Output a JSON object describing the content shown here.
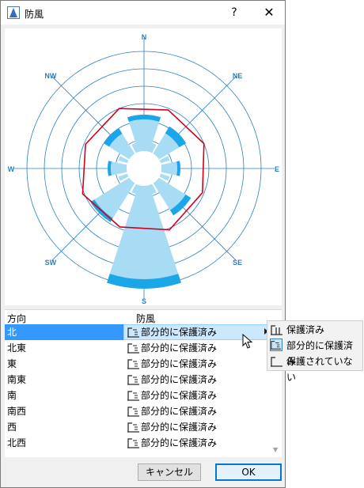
{
  "window": {
    "title": "防風",
    "help_label": "?",
    "close_label": "✕"
  },
  "chart_data": {
    "type": "rose",
    "directions": [
      "N",
      "NE",
      "E",
      "SE",
      "S",
      "SW",
      "W",
      "NW"
    ],
    "colors": {
      "light": "#a8dcf5",
      "mid": "#1aa6e8",
      "dark": "#0d6ab8",
      "outline": "#d0021b",
      "grid": "#2a7fc1"
    }
  },
  "list": {
    "headers": {
      "direction": "方向",
      "protection": "防風"
    },
    "rows": [
      {
        "direction": "北",
        "protection": "部分的に保護済み"
      },
      {
        "direction": "北東",
        "protection": "部分的に保護済み"
      },
      {
        "direction": "東",
        "protection": "部分的に保護済み"
      },
      {
        "direction": "南東",
        "protection": "部分的に保護済み"
      },
      {
        "direction": "南",
        "protection": "部分的に保護済み"
      },
      {
        "direction": "南西",
        "protection": "部分的に保護済み"
      },
      {
        "direction": "西",
        "protection": "部分的に保護済み"
      },
      {
        "direction": "北西",
        "protection": "部分的に保護済み"
      }
    ],
    "selected_index": 0
  },
  "popup_menu": {
    "items": [
      {
        "label": "保護済み",
        "icon": "fully-protected-icon"
      },
      {
        "label": "部分的に保護済み",
        "icon": "partially-protected-icon"
      },
      {
        "label": "保護されていない",
        "icon": "unprotected-icon"
      }
    ],
    "current_index": 1
  },
  "buttons": {
    "cancel": "キャンセル",
    "ok": "OK"
  }
}
